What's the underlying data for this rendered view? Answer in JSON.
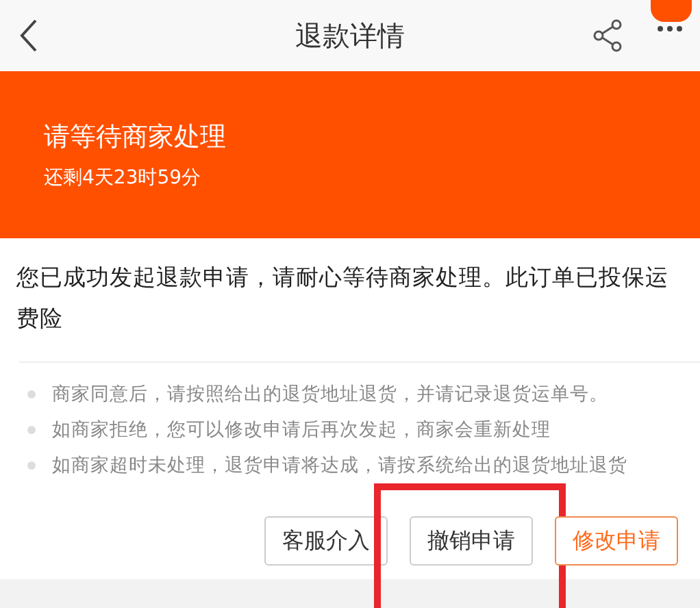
{
  "header": {
    "title": "退款详情"
  },
  "banner": {
    "title": "请等待商家处理",
    "countdown": "还剩4天23时59分"
  },
  "message": "您已成功发起退款申请，请耐心等待商家处理。此订单已投保运费险",
  "notes": [
    "商家同意后，请按照给出的退货地址退货，并请记录退货运单号。",
    "如商家拒绝，您可以修改申请后再次发起，商家会重新处理",
    "如商家超时未处理，退货申请将达成，请按系统给出的退货地址退货"
  ],
  "buttons": [
    {
      "label": "客服介入",
      "kind": "default",
      "highlighted": false
    },
    {
      "label": "撤销申请",
      "kind": "default",
      "highlighted": true
    },
    {
      "label": "修改申请",
      "kind": "primary",
      "highlighted": false
    }
  ]
}
